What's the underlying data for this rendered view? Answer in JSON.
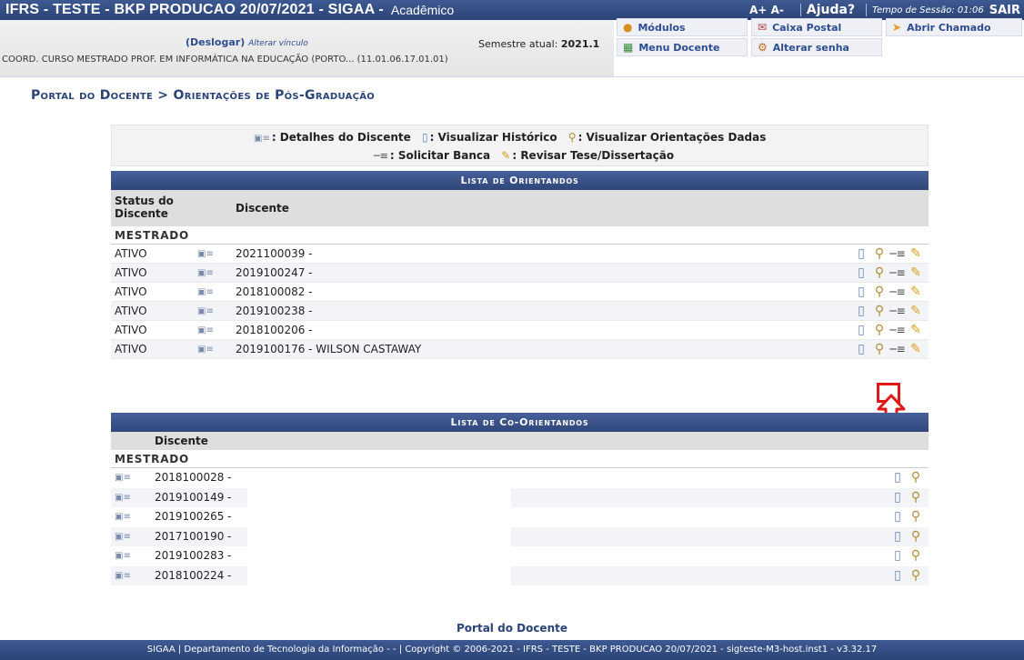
{
  "topbar": {
    "system": "IFRS - TESTE - BKP PRODUCAO 20/07/2021 - SIGAA -",
    "module": "Acadêmico",
    "font_controls": "A+ A-",
    "help": "Ajuda?",
    "session": "Tempo de Sessão: 01:06",
    "exit": "SAIR"
  },
  "info": {
    "deslogar": "(Deslogar)",
    "alterar_vinculo": "Alterar vínculo",
    "semestre_label": "Semestre atual:",
    "semestre_value": "2021.1",
    "unit": "COORD. CURSO MESTRADO PROF. EM INFORMÁTICA NA EDUCAÇÃO (PORTO... (11.01.06.17.01.01)"
  },
  "modules": {
    "modulos": "Módulos",
    "caixa_postal": "Caixa Postal",
    "abrir_chamado": "Abrir Chamado",
    "menu_docente": "Menu Docente",
    "alterar_senha": "Alterar senha"
  },
  "breadcrumb": "Portal do Docente > Orientações de Pós-Graduação",
  "legend": {
    "detalhes": ": Detalhes do Discente",
    "historico": ": Visualizar Histórico",
    "orientacoes": ": Visualizar Orientações Dadas",
    "banca": ": Solicitar Banca",
    "revisar": ": Revisar Tese/Dissertação"
  },
  "orientandos": {
    "title": "Lista de Orientandos",
    "col_status": "Status do Discente",
    "col_discente": "Discente",
    "group": "MESTRADO",
    "rows": [
      {
        "status": "ATIVO",
        "discente": "2021100039 -"
      },
      {
        "status": "ATIVO",
        "discente": "2019100247 -"
      },
      {
        "status": "ATIVO",
        "discente": "2018100082 -"
      },
      {
        "status": "ATIVO",
        "discente": "2019100238 -"
      },
      {
        "status": "ATIVO",
        "discente": "2018100206 -"
      },
      {
        "status": "ATIVO",
        "discente": "2019100176 - WILSON CASTAWAY"
      }
    ]
  },
  "coorientandos": {
    "title": "Lista de Co-Orientandos",
    "col_discente": "Discente",
    "group": "MESTRADO",
    "rows": [
      {
        "discente": "2018100028 -"
      },
      {
        "discente": "2019100149 -"
      },
      {
        "discente": "2019100265 -"
      },
      {
        "discente": "2017100190 -"
      },
      {
        "discente": "2019100283 -"
      },
      {
        "discente": "2018100224 -"
      }
    ]
  },
  "footer": {
    "link": "Portal do Docente",
    "text": "SIGAA | Departamento de Tecnologia da Informação - - | Copyright © 2006-2021 - IFRS - TESTE - BKP PRODUCAO 20/07/2021 - sigteste-M3-host.inst1 - v3.32.17"
  },
  "colors": {
    "header_blue": "#2b4476",
    "highlight_red": "#e01818"
  }
}
